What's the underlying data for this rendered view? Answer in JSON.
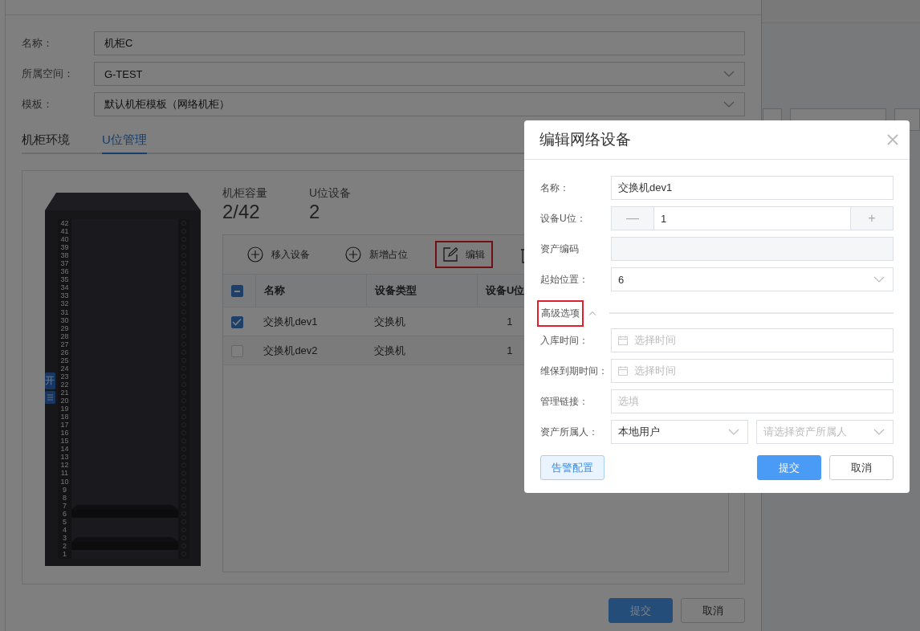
{
  "drawer": {
    "fields": [
      {
        "label": "名称：",
        "kind": "text",
        "value": "机柜C"
      },
      {
        "label": "所属空间：",
        "kind": "select",
        "value": "G-TEST"
      },
      {
        "label": "模板：",
        "kind": "select",
        "value": "默认机柜模板（网络机柜）"
      }
    ],
    "tabs": [
      {
        "label": "机柜环境",
        "selected": false
      },
      {
        "label": "U位管理",
        "selected": true
      }
    ],
    "rack": {
      "units": [
        {
          "label": "42",
          "occupied": false
        },
        {
          "label": "41",
          "occupied": false
        },
        {
          "label": "40",
          "occupied": false
        },
        {
          "label": "39",
          "occupied": false
        },
        {
          "label": "38",
          "occupied": false
        },
        {
          "label": "37",
          "occupied": false
        },
        {
          "label": "36",
          "occupied": false
        },
        {
          "label": "35",
          "occupied": false
        },
        {
          "label": "34",
          "occupied": false
        },
        {
          "label": "33",
          "occupied": false
        },
        {
          "label": "32",
          "occupied": false
        },
        {
          "label": "31",
          "occupied": false
        },
        {
          "label": "30",
          "occupied": false
        },
        {
          "label": "29",
          "occupied": false
        },
        {
          "label": "28",
          "occupied": false
        },
        {
          "label": "27",
          "occupied": false
        },
        {
          "label": "26",
          "occupied": false
        },
        {
          "label": "25",
          "occupied": false
        },
        {
          "label": "24",
          "occupied": false
        },
        {
          "label": "23",
          "occupied": false
        },
        {
          "label": "22",
          "occupied": false
        },
        {
          "label": "21",
          "occupied": false
        },
        {
          "label": "20",
          "occupied": false
        },
        {
          "label": "19",
          "occupied": false
        },
        {
          "label": "18",
          "occupied": false
        },
        {
          "label": "17",
          "occupied": false
        },
        {
          "label": "16",
          "occupied": false
        },
        {
          "label": "15",
          "occupied": false
        },
        {
          "label": "14",
          "occupied": false
        },
        {
          "label": "13",
          "occupied": false
        },
        {
          "label": "12",
          "occupied": false
        },
        {
          "label": "11",
          "occupied": false
        },
        {
          "label": "10",
          "occupied": false
        },
        {
          "label": "9",
          "occupied": false
        },
        {
          "label": "8",
          "occupied": false
        },
        {
          "label": "7",
          "occupied": false
        },
        {
          "label": "6",
          "occupied": true
        },
        {
          "label": "5",
          "occupied": false
        },
        {
          "label": "4",
          "occupied": false
        },
        {
          "label": "3",
          "occupied": false
        },
        {
          "label": "2",
          "occupied": true
        },
        {
          "label": "1",
          "occupied": false
        }
      ],
      "side_tab": {
        "label": "开"
      }
    },
    "stats": [
      {
        "label": "机柜容量",
        "value": "2/42"
      },
      {
        "label": "U位设备",
        "value": "2"
      }
    ],
    "toolbar": [
      {
        "kind": "add",
        "label": "移入设备",
        "highlighted": false
      },
      {
        "kind": "add",
        "label": "新增占位",
        "highlighted": false
      },
      {
        "kind": "edit",
        "label": "编辑",
        "highlighted": true
      },
      {
        "kind": "delete",
        "highlighted": false
      }
    ],
    "table": {
      "select_all": {
        "indeterminate": true
      },
      "columns": [
        "名称",
        "设备类型",
        "设备U位"
      ],
      "rows": [
        {
          "selected": true,
          "cells": [
            "交换机dev1",
            "交换机",
            "1"
          ]
        },
        {
          "selected": false,
          "cells": [
            "交换机dev2",
            "交换机",
            "1"
          ]
        }
      ]
    },
    "buttons": [
      {
        "kind": "primary",
        "label": "提交"
      },
      {
        "kind": "default",
        "label": "取消"
      }
    ]
  },
  "modal": {
    "title": "编辑网络设备",
    "fields": [
      {
        "kind": "text",
        "label": "名称：",
        "value": "交换机dev1"
      },
      {
        "kind": "stepper",
        "label": "设备U位：",
        "value": "1",
        "minus": "—",
        "plus": "+"
      },
      {
        "kind": "readonly",
        "label": "资产编码"
      },
      {
        "kind": "select",
        "label": "起始位置：",
        "value": "6"
      }
    ],
    "advanced": {
      "label": "高级选项",
      "expanded": true,
      "highlighted": true
    },
    "advanced_fields": [
      {
        "kind": "date",
        "label": "入库时间：",
        "placeholder": "选择时间"
      },
      {
        "kind": "date",
        "label": "维保到期时间：",
        "placeholder": "选择时间"
      },
      {
        "kind": "text",
        "label": "管理链接：",
        "placeholder": "选填"
      },
      {
        "kind": "double_select",
        "label": "资产所属人：",
        "value": "本地用户",
        "placeholder": "请选择资产所属人"
      }
    ],
    "buttons": [
      {
        "kind": "light",
        "label": "告警配置"
      },
      {
        "kind": "primary",
        "label": "提交"
      },
      {
        "kind": "default",
        "label": "取消"
      }
    ]
  }
}
